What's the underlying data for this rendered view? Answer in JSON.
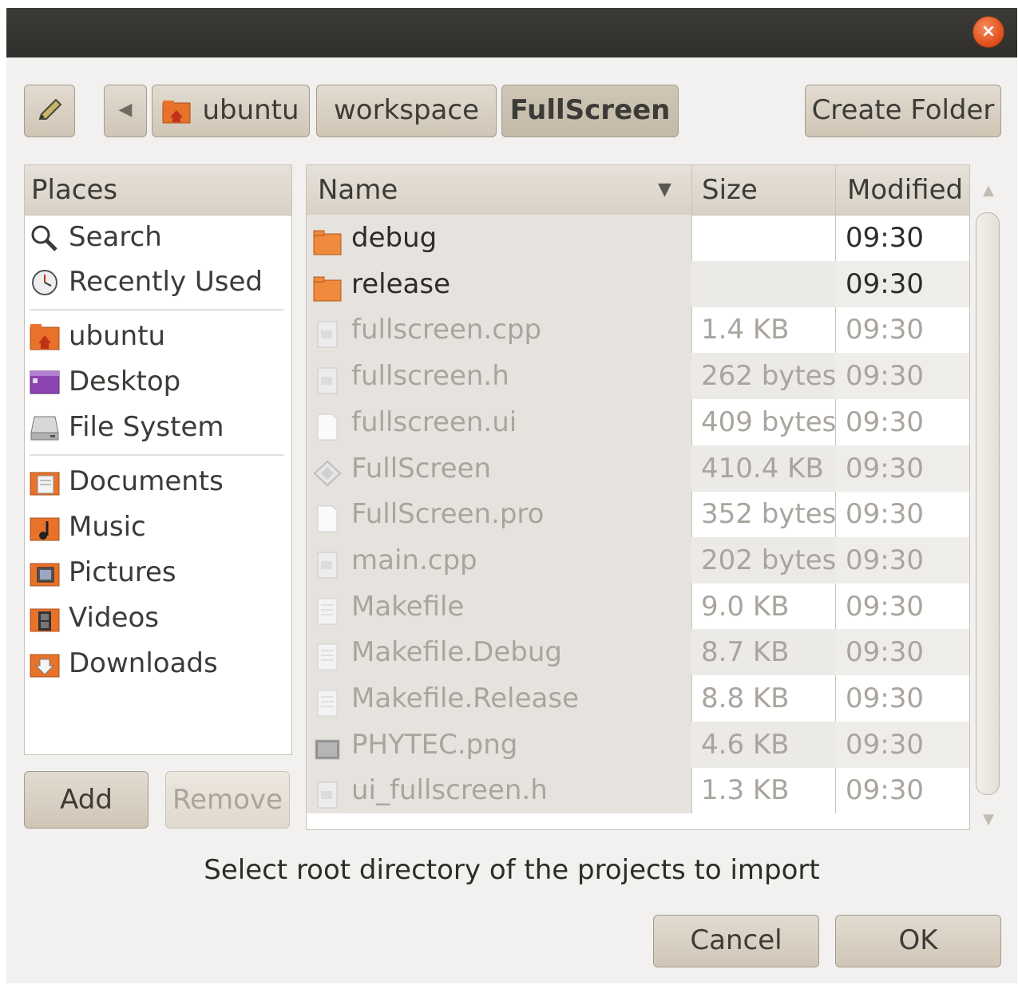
{
  "titlebar": {
    "close_label": "×"
  },
  "toolbar": {
    "crumbs": [
      {
        "label": "ubuntu"
      },
      {
        "label": "workspace"
      },
      {
        "label": "FullScreen"
      }
    ],
    "back_arrow": "◀",
    "create_folder_label": "Create Folder"
  },
  "places": {
    "header": "Places",
    "items": [
      {
        "label": "Search",
        "icon": "search-icon"
      },
      {
        "label": "Recently Used",
        "icon": "clock-icon"
      },
      {
        "label": "ubuntu",
        "icon": "home-folder-icon"
      },
      {
        "label": "Desktop",
        "icon": "desktop-icon"
      },
      {
        "label": "File System",
        "icon": "drive-icon"
      },
      {
        "label": "Documents",
        "icon": "documents-folder-icon"
      },
      {
        "label": "Music",
        "icon": "music-folder-icon"
      },
      {
        "label": "Pictures",
        "icon": "pictures-folder-icon"
      },
      {
        "label": "Videos",
        "icon": "videos-folder-icon"
      },
      {
        "label": "Downloads",
        "icon": "downloads-folder-icon"
      }
    ],
    "add_label": "Add",
    "remove_label": "Remove"
  },
  "files": {
    "columns": {
      "name": "Name",
      "size": "Size",
      "modified": "Modified",
      "sort_indicator": "▼"
    },
    "rows": [
      {
        "name": "debug",
        "size": "",
        "modified": "09:30",
        "type": "folder"
      },
      {
        "name": "release",
        "size": "",
        "modified": "09:30",
        "type": "folder"
      },
      {
        "name": "fullscreen.cpp",
        "size": "1.4 KB",
        "modified": "09:30",
        "type": "source"
      },
      {
        "name": "fullscreen.h",
        "size": "262 bytes",
        "modified": "09:30",
        "type": "source"
      },
      {
        "name": "fullscreen.ui",
        "size": "409 bytes",
        "modified": "09:30",
        "type": "blank"
      },
      {
        "name": "FullScreen",
        "size": "410.4 KB",
        "modified": "09:30",
        "type": "exec"
      },
      {
        "name": "FullScreen.pro",
        "size": "352 bytes",
        "modified": "09:30",
        "type": "blank"
      },
      {
        "name": "main.cpp",
        "size": "202 bytes",
        "modified": "09:30",
        "type": "source"
      },
      {
        "name": "Makefile",
        "size": "9.0 KB",
        "modified": "09:30",
        "type": "text"
      },
      {
        "name": "Makefile.Debug",
        "size": "8.7 KB",
        "modified": "09:30",
        "type": "text"
      },
      {
        "name": "Makefile.Release",
        "size": "8.8 KB",
        "modified": "09:30",
        "type": "text"
      },
      {
        "name": "PHYTEC.png",
        "size": "4.6 KB",
        "modified": "09:30",
        "type": "image"
      },
      {
        "name": "ui_fullscreen.h",
        "size": "1.3 KB",
        "modified": "09:30",
        "type": "source"
      }
    ]
  },
  "status": {
    "message": "Select root directory of the projects to import"
  },
  "dialog": {
    "cancel_label": "Cancel",
    "ok_label": "OK"
  }
}
